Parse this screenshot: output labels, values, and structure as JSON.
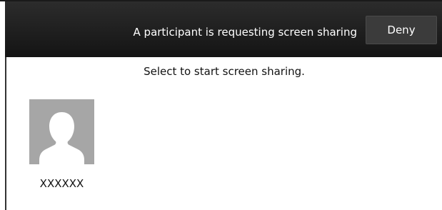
{
  "header": {
    "request_text": "A participant is requesting screen sharing",
    "deny_label": "Deny"
  },
  "main": {
    "instruction": "Select to start screen sharing.",
    "participants": [
      {
        "name": "XXXXXX",
        "icon": "user-silhouette-icon"
      }
    ]
  },
  "colors": {
    "header_background": "#1e1e1e",
    "deny_button_background": "#3b3b3b",
    "avatar_background": "#a6a6a6",
    "avatar_silhouette": "#ffffff"
  }
}
